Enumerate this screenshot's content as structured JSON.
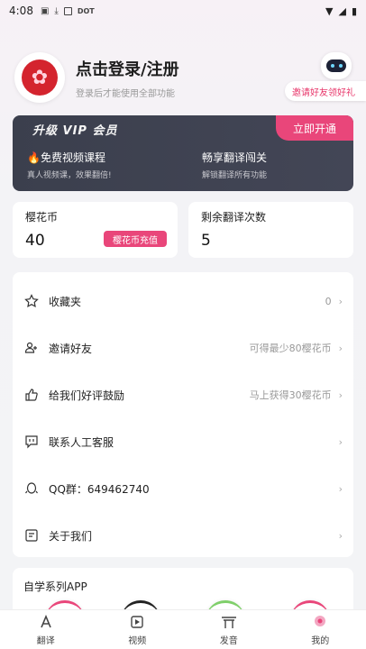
{
  "status": {
    "time": "4:08",
    "dot_label": "DOT"
  },
  "profile": {
    "title": "点击登录/注册",
    "subtitle": "登录后才能使用全部功能"
  },
  "invite": {
    "label": "邀请好友领好礼"
  },
  "vip": {
    "title": "升级 VIP 会员",
    "button": "立即开通",
    "features": [
      {
        "title": "🔥免费视频课程",
        "subtitle": "真人视频课，效果翻倍!"
      },
      {
        "title": "畅享翻译闯关",
        "subtitle": "解锁翻译所有功能"
      }
    ]
  },
  "stats": {
    "coins": {
      "label": "樱花币",
      "value": "40",
      "button": "樱花币充值"
    },
    "translations": {
      "label": "剩余翻译次数",
      "value": "5"
    }
  },
  "menu": [
    {
      "icon": "star-icon",
      "label": "收藏夹",
      "right": "0"
    },
    {
      "icon": "invite-icon",
      "label": "邀请好友",
      "right": "可得最少80樱花币"
    },
    {
      "icon": "thumbs-up-icon",
      "label": "给我们好评鼓励",
      "right": "马上获得30樱花币"
    },
    {
      "icon": "chat-icon",
      "label": "联系人工客服",
      "right": ""
    },
    {
      "icon": "qq-icon",
      "label": "QQ群：649462740",
      "right": ""
    },
    {
      "icon": "about-icon",
      "label": "关于我们",
      "right": ""
    }
  ],
  "apps": {
    "title": "自学系列APP"
  },
  "nav": [
    {
      "icon": "translate-icon",
      "label": "翻译"
    },
    {
      "icon": "video-icon",
      "label": "视频"
    },
    {
      "icon": "pronunciation-icon",
      "label": "发音"
    },
    {
      "icon": "profile-icon",
      "label": "我的"
    }
  ],
  "colors": {
    "accent": "#e9467a",
    "vip_bg": "#3b3f4d"
  }
}
